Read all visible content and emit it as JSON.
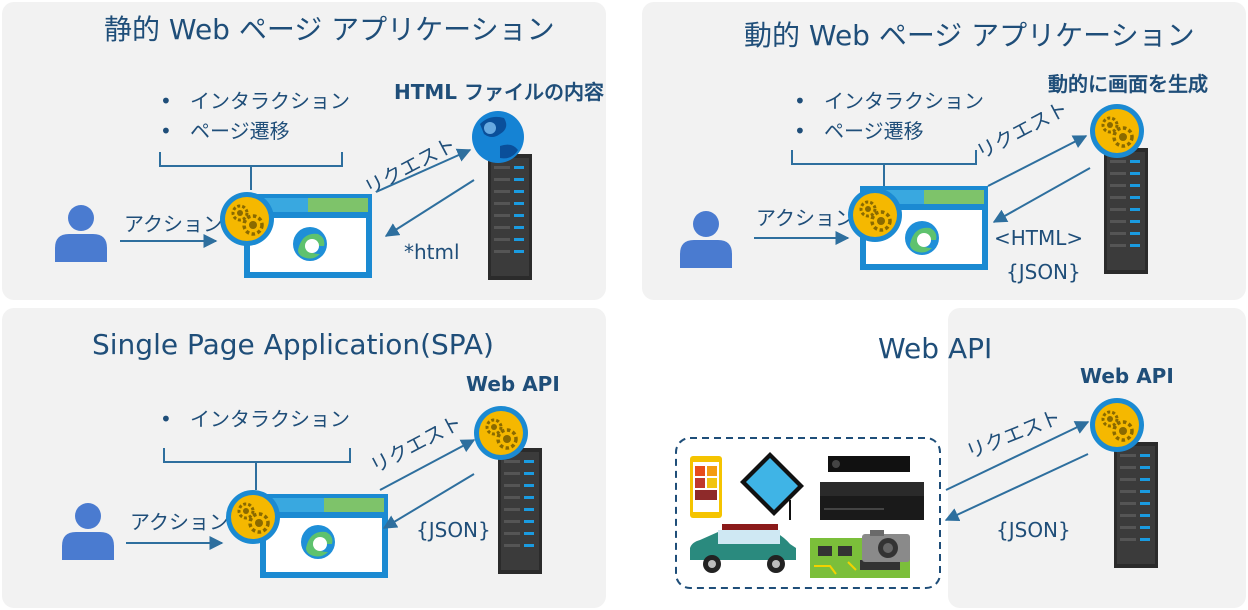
{
  "static_panel": {
    "title": "静的 Web ページ アプリケーション",
    "bullets": [
      "インタラクション",
      "ページ遷移"
    ],
    "action": "アクション",
    "request": "リクエスト",
    "response": "*html",
    "server_label": "HTML ファイルの内容"
  },
  "dynamic_panel": {
    "title": "動的 Web ページ アプリケーション",
    "bullets": [
      "インタラクション",
      "ページ遷移"
    ],
    "action": "アクション",
    "request": "リクエスト",
    "response_1": "<HTML>",
    "response_2": "{JSON}",
    "server_label": "動的に画面を生成"
  },
  "spa_panel": {
    "title": "Single Page Application(SPA)",
    "bullets": [
      "インタラクション"
    ],
    "action": "アクション",
    "request": "リクエスト",
    "response": "{JSON}",
    "server_label": "Web API"
  },
  "webapi_panel": {
    "title": "Web API",
    "request": "リクエスト",
    "response": "{JSON}",
    "server_label": "Web API"
  },
  "colors": {
    "panel_bg": "#f2f2f2",
    "text": "#1f4e79",
    "arrow": "#2e6f9e",
    "browser_blue": "#1b8ad2",
    "gear_yellow": "#f5b800",
    "person_blue": "#4a7bd0"
  }
}
